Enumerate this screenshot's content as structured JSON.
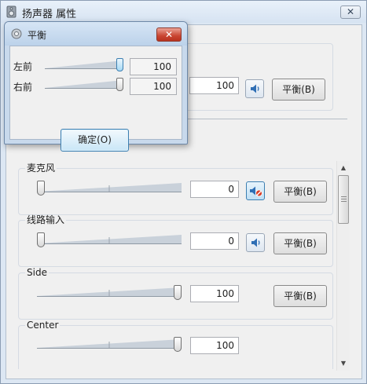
{
  "main_window": {
    "title": "扬声器 属性",
    "close_label": "✕"
  },
  "master": {
    "value": "100",
    "balance_label": "平衡(B)"
  },
  "devices": [
    {
      "name": "麦克风",
      "value": "0",
      "level": 0,
      "muted": true,
      "has_speaker": true,
      "balance_label": "平衡(B)"
    },
    {
      "name": "线路输入",
      "value": "0",
      "level": 0,
      "muted": false,
      "has_speaker": true,
      "balance_label": "平衡(B)"
    },
    {
      "name": "Side",
      "value": "100",
      "level": 100,
      "has_speaker": false,
      "balance_label": "平衡(B)"
    },
    {
      "name": "Center",
      "value": "100",
      "level": 100,
      "has_speaker": false
    }
  ],
  "balance_dialog": {
    "title": "平衡",
    "close_label": "✕",
    "channels": [
      {
        "label": "左前",
        "value": "100",
        "level": 100
      },
      {
        "label": "右前",
        "value": "100",
        "level": 100
      }
    ],
    "ok_label": "确定(O)"
  },
  "colors": {
    "window_frame": "#dce7f3",
    "popup_frame": "#c8d9ec",
    "close_red": "#c94632",
    "accent_blue": "#3c7fb1"
  }
}
